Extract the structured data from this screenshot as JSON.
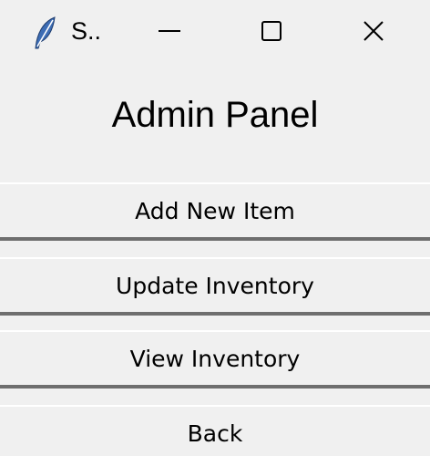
{
  "window": {
    "title": "S..",
    "app_icon": "feather-icon",
    "controls": {
      "minimize_icon": "minimize-icon",
      "maximize_icon": "maximize-icon",
      "close_icon": "close-icon"
    }
  },
  "panel": {
    "heading": "Admin Panel",
    "buttons": [
      {
        "label": "Add New Item"
      },
      {
        "label": "Update Inventory"
      },
      {
        "label": "View Inventory"
      },
      {
        "label": "Back"
      }
    ]
  },
  "colors": {
    "background": "#f0f0f0",
    "button_shadow": "#6e6e6e",
    "text": "#000000",
    "feather_blue": "#3c6cb4"
  }
}
